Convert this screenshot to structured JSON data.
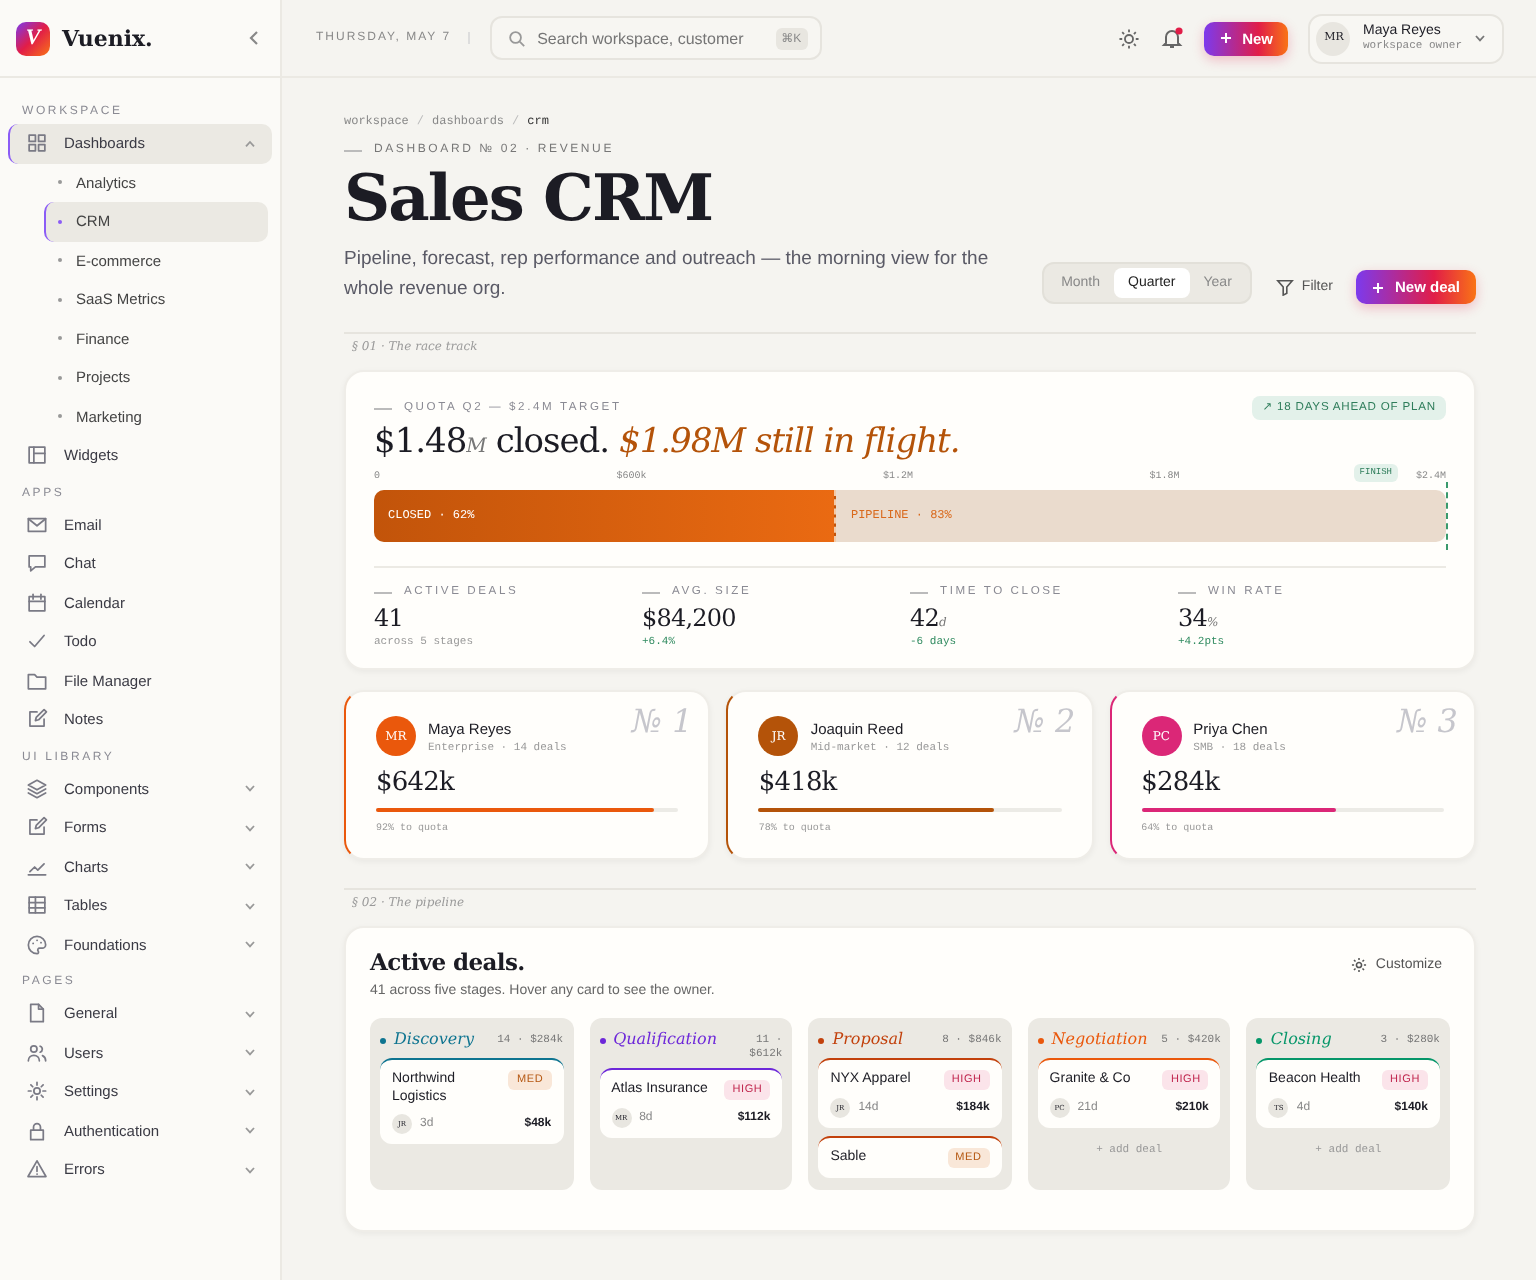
{
  "sidebar": {
    "logo_letter": "V",
    "brand": "Vuenix.",
    "sections": [
      {
        "title": "WORKSPACE",
        "items": [
          {
            "label": "Dashboards",
            "active_parent": true,
            "expanded": true,
            "children": [
              {
                "label": "Analytics",
                "selected": false
              },
              {
                "label": "CRM",
                "selected": true
              },
              {
                "label": "E-commerce",
                "selected": false
              },
              {
                "label": "SaaS Metrics",
                "selected": false
              },
              {
                "label": "Finance",
                "selected": false
              },
              {
                "label": "Projects",
                "selected": false
              },
              {
                "label": "Marketing",
                "selected": false
              }
            ]
          },
          {
            "label": "Widgets",
            "active_parent": false
          }
        ]
      },
      {
        "title": "APPS",
        "items": [
          {
            "label": "Email",
            "active_parent": false
          },
          {
            "label": "Chat",
            "active_parent": false
          },
          {
            "label": "Calendar",
            "active_parent": false
          },
          {
            "label": "Todo",
            "active_parent": false
          },
          {
            "label": "File Manager",
            "active_parent": false
          },
          {
            "label": "Notes",
            "active_parent": false
          }
        ]
      },
      {
        "title": "UI LIBRARY",
        "items": [
          {
            "label": "Components",
            "active_parent": false,
            "expanded": false
          },
          {
            "label": "Forms",
            "active_parent": false,
            "expanded": false
          },
          {
            "label": "Charts",
            "active_parent": false,
            "expanded": false
          },
          {
            "label": "Tables",
            "active_parent": false,
            "expanded": false
          },
          {
            "label": "Foundations",
            "active_parent": false,
            "expanded": false
          }
        ]
      },
      {
        "title": "PAGES",
        "items": [
          {
            "label": "General",
            "active_parent": false,
            "expanded": false
          },
          {
            "label": "Users",
            "active_parent": false,
            "expanded": false
          },
          {
            "label": "Settings",
            "active_parent": false,
            "expanded": false
          },
          {
            "label": "Authentication",
            "active_parent": false,
            "expanded": false
          },
          {
            "label": "Errors",
            "active_parent": false,
            "expanded": false
          }
        ]
      }
    ]
  },
  "header": {
    "date": "THURSDAY, MAY 7",
    "search": {
      "placeholder": "Search workspace, customer",
      "shortcut": "⌘K"
    },
    "notifications_unread": true,
    "new_button": "New",
    "user": {
      "initials": "MR",
      "name": "Maya Reyes",
      "role": "workspace owner"
    }
  },
  "page": {
    "breadcrumbs": [
      "workspace",
      "dashboards",
      "crm"
    ],
    "breadcrumb_separator": "/",
    "eyebrow": "DASHBOARD № 02 · REVENUE",
    "title": "Sales CRM",
    "subtitle": "Pipeline, forecast, rep performance and outreach — the morning view for the whole revenue org.",
    "periods": [
      {
        "label": "Month",
        "selected": false
      },
      {
        "label": "Quarter",
        "selected": true
      },
      {
        "label": "Year",
        "selected": false
      }
    ],
    "filter": "Filter",
    "new_deal": "New deal"
  },
  "race_track": {
    "section_label": "§ 01 · The race track",
    "eyebrow": "QUOTA Q2 — $2.4M TARGET",
    "closed_value": "$1.48",
    "closed_unit": "M",
    "closed_word": "closed.",
    "in_flight": "$1.98M still in flight.",
    "badge": "↗ 18 DAYS AHEAD OF PLAN",
    "ticks": [
      "0",
      "$600k",
      "$1.2M",
      "$1.8M",
      "$2.4M"
    ],
    "finish": "FINISH",
    "closed": {
      "label": "CLOSED · 62%",
      "level": 0.43
    },
    "pipeline": {
      "label": "PIPELINE · 83%"
    },
    "stats": [
      {
        "label": "ACTIVE DEALS",
        "value": "41",
        "note": "across 5 stages",
        "positive": false
      },
      {
        "label": "AVG. SIZE",
        "value": "$84,200",
        "note": "+6.4%",
        "positive": true
      },
      {
        "label": "TIME TO CLOSE",
        "value": "42",
        "unit": "d",
        "note": "-6 days",
        "positive": true
      },
      {
        "label": "WIN RATE",
        "value": "34",
        "unit": "%",
        "note": "+4.2pts",
        "positive": true
      }
    ]
  },
  "reps": [
    {
      "rank": "№ 1",
      "initials": "MR",
      "name": "Maya Reyes",
      "segment": "Enterprise · 14 deals",
      "amount": "$642k",
      "level": 0.92,
      "note": "92% to quota",
      "color": "#ea580c"
    },
    {
      "rank": "№ 2",
      "initials": "JR",
      "name": "Joaquin Reed",
      "segment": "Mid-market · 12 deals",
      "amount": "$418k",
      "level": 0.78,
      "note": "78% to quota",
      "color": "#b45309"
    },
    {
      "rank": "№ 3",
      "initials": "PC",
      "name": "Priya Chen",
      "segment": "SMB · 18 deals",
      "amount": "$284k",
      "level": 0.64,
      "note": "64% to quota",
      "color": "#db2777"
    }
  ],
  "pipeline": {
    "section_label": "§ 02 · The pipeline",
    "title": "Active deals.",
    "subtitle": "41 across five stages. Hover any card to see the owner.",
    "customize": "Customize",
    "columns": [
      {
        "name": "Discovery",
        "color": "#0e7490",
        "count": "14 · $284k",
        "cards": [
          {
            "company": "Northwind Logistics",
            "priority": "MED",
            "owner": "JR",
            "age": "3d",
            "value": "$48k"
          }
        ]
      },
      {
        "name": "Qualification",
        "color": "#6d28d9",
        "count": "11 · $612k",
        "cards": [
          {
            "company": "Atlas Insurance",
            "priority": "HIGH",
            "owner": "MR",
            "age": "8d",
            "value": "$112k"
          }
        ]
      },
      {
        "name": "Proposal",
        "color": "#c2410c",
        "count": "8 · $846k",
        "cards": [
          {
            "company": "NYX Apparel",
            "priority": "HIGH",
            "owner": "JR",
            "age": "14d",
            "value": "$184k"
          },
          {
            "company": "Sable",
            "priority": "MED"
          }
        ]
      },
      {
        "name": "Negotiation",
        "color": "#ea580c",
        "count": "5 · $420k",
        "cards": [
          {
            "company": "Granite & Co",
            "priority": "HIGH",
            "owner": "PC",
            "age": "21d",
            "value": "$210k"
          }
        ],
        "add": "+ add deal"
      },
      {
        "name": "Closing",
        "color": "#059669",
        "count": "3 · $280k",
        "cards": [
          {
            "company": "Beacon Health",
            "priority": "HIGH",
            "owner": "TS",
            "age": "4d",
            "value": "$140k"
          }
        ],
        "add": "+ add deal"
      }
    ]
  }
}
